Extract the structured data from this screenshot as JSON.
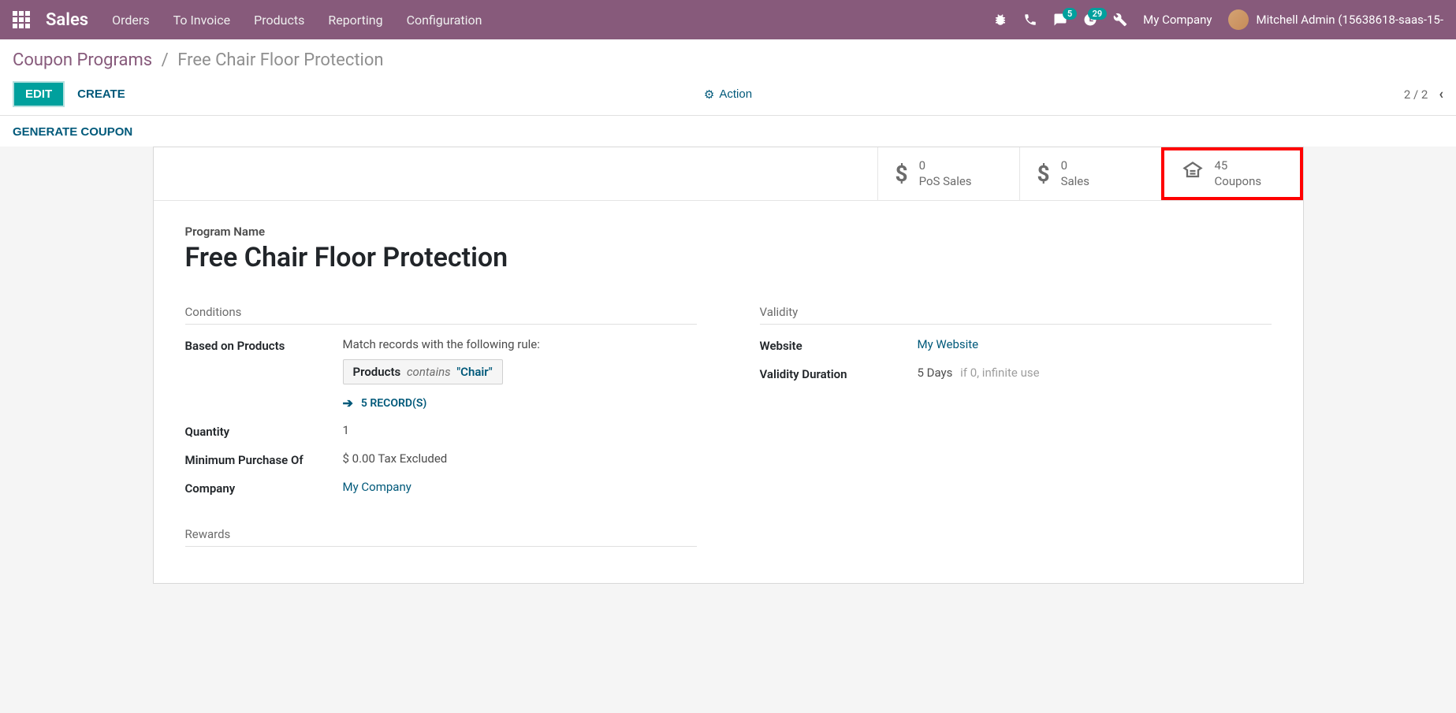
{
  "navbar": {
    "brand": "Sales",
    "items": [
      "Orders",
      "To Invoice",
      "Products",
      "Reporting",
      "Configuration"
    ],
    "messages_badge": "5",
    "activities_badge": "29",
    "company": "My Company",
    "user": "Mitchell Admin (15638618-saas-15-"
  },
  "breadcrumb": {
    "parent": "Coupon Programs",
    "current": "Free Chair Floor Protection"
  },
  "toolbar": {
    "edit": "EDIT",
    "create": "CREATE",
    "action": "Action",
    "pager": "2 / 2",
    "generate": "GENERATE COUPON"
  },
  "stats": {
    "pos_sales": {
      "value": "0",
      "label": "PoS Sales"
    },
    "sales": {
      "value": "0",
      "label": "Sales"
    },
    "coupons": {
      "value": "45",
      "label": "Coupons"
    }
  },
  "form": {
    "program_label": "Program Name",
    "program_name": "Free Chair Floor Protection",
    "conditions_title": "Conditions",
    "based_on_products_label": "Based on Products",
    "rule_intro": "Match records with the following rule:",
    "domain_field": "Products",
    "domain_op": "contains",
    "domain_value": "\"Chair\"",
    "records_count": "5 RECORD(S)",
    "quantity_label": "Quantity",
    "quantity_value": "1",
    "min_purchase_label": "Minimum Purchase Of",
    "min_purchase_value": "$ 0.00  Tax Excluded",
    "company_label": "Company",
    "company_value": "My Company",
    "validity_title": "Validity",
    "website_label": "Website",
    "website_value": "My Website",
    "validity_duration_label": "Validity Duration",
    "validity_duration_value": "5 Days",
    "validity_duration_hint": "if 0, infinite use",
    "rewards_title": "Rewards"
  }
}
